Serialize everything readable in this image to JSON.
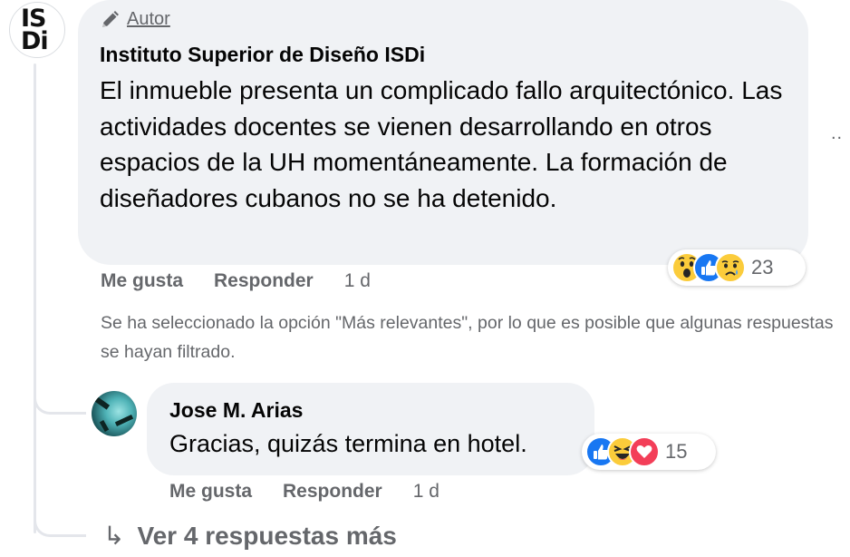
{
  "main_comment": {
    "avatar_logo_top": "IS",
    "avatar_logo_bottom": "Di",
    "badge_label": "Autor",
    "author": "Instituto Superior de Diseño ISDi",
    "text": "El inmueble presenta un complicado fallo arquitectónico. Las actividades docentes se vienen desarrollando en otros espacios de la UH momentáneamente. La formación de diseñadores cubanos no se ha detenido.",
    "reactions": {
      "icons": [
        "wow-icon",
        "like-icon",
        "sad-icon"
      ],
      "count": "23"
    },
    "actions": {
      "like": "Me gusta",
      "reply": "Responder",
      "time": "1 d"
    },
    "more_icon": "more-dots-icon",
    "more_label": ".."
  },
  "filter_note": "Se ha seleccionado la opción \"Más relevantes\", por lo que es posible que algunas respuestas se hayan filtrado.",
  "reply_comment": {
    "author": "Jose M. Arias",
    "text": "Gracias, quizás termina en hotel.",
    "reactions": {
      "icons": [
        "like-icon",
        "haha-icon",
        "love-icon"
      ],
      "count": "15"
    },
    "actions": {
      "like": "Me gusta",
      "reply": "Responder",
      "time": "1 d"
    }
  },
  "view_more": {
    "arrow": "↳",
    "label": "Ver 4 respuestas más"
  },
  "colors": {
    "bubble": "#f0f2f5",
    "secondary_text": "#65676b",
    "like_blue": "#1877f2",
    "love_red": "#f33e58",
    "emoji_yellow": "#fbcc3b"
  }
}
